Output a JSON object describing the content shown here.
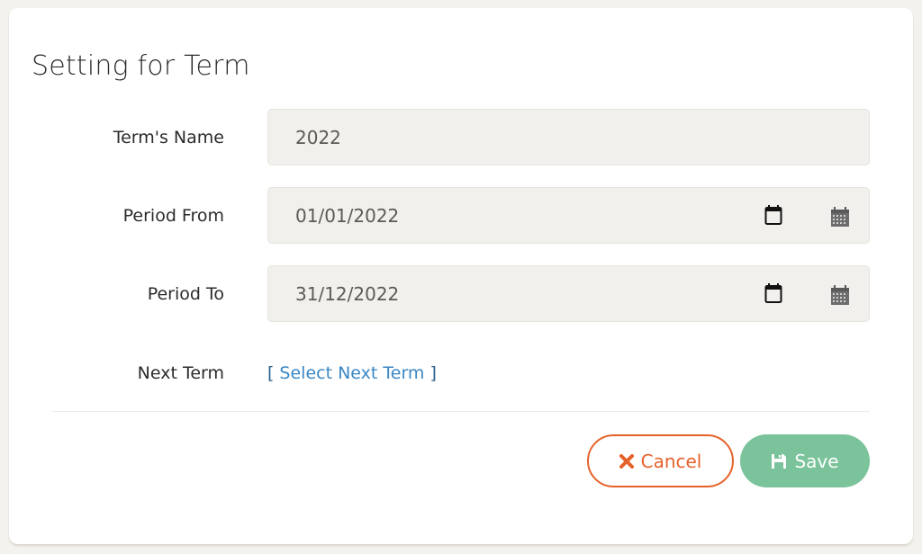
{
  "form": {
    "title": "Setting for Term",
    "fields": [
      {
        "label": "Term's Name",
        "value": "2022",
        "type": "text"
      },
      {
        "label": "Period From",
        "value": "01/01/2022",
        "type": "date",
        "icons": [
          "calendar-native-icon",
          "calendar-icon"
        ]
      },
      {
        "label": "Period To",
        "value": "31/12/2022",
        "type": "date",
        "icons": [
          "calendar-native-icon",
          "calendar-icon"
        ]
      }
    ],
    "next_term": {
      "label": "Next Term",
      "link_open": "[",
      "link_text": "Select Next Term",
      "link_close": "]"
    }
  },
  "actions": {
    "cancel_label": "Cancel",
    "cancel_icon": "x-icon",
    "save_label": "Save",
    "save_icon": "floppy-disk-icon"
  },
  "colors": {
    "cancel": "#e6622b",
    "save": "#7ac39b",
    "link": "#3b87c4"
  }
}
